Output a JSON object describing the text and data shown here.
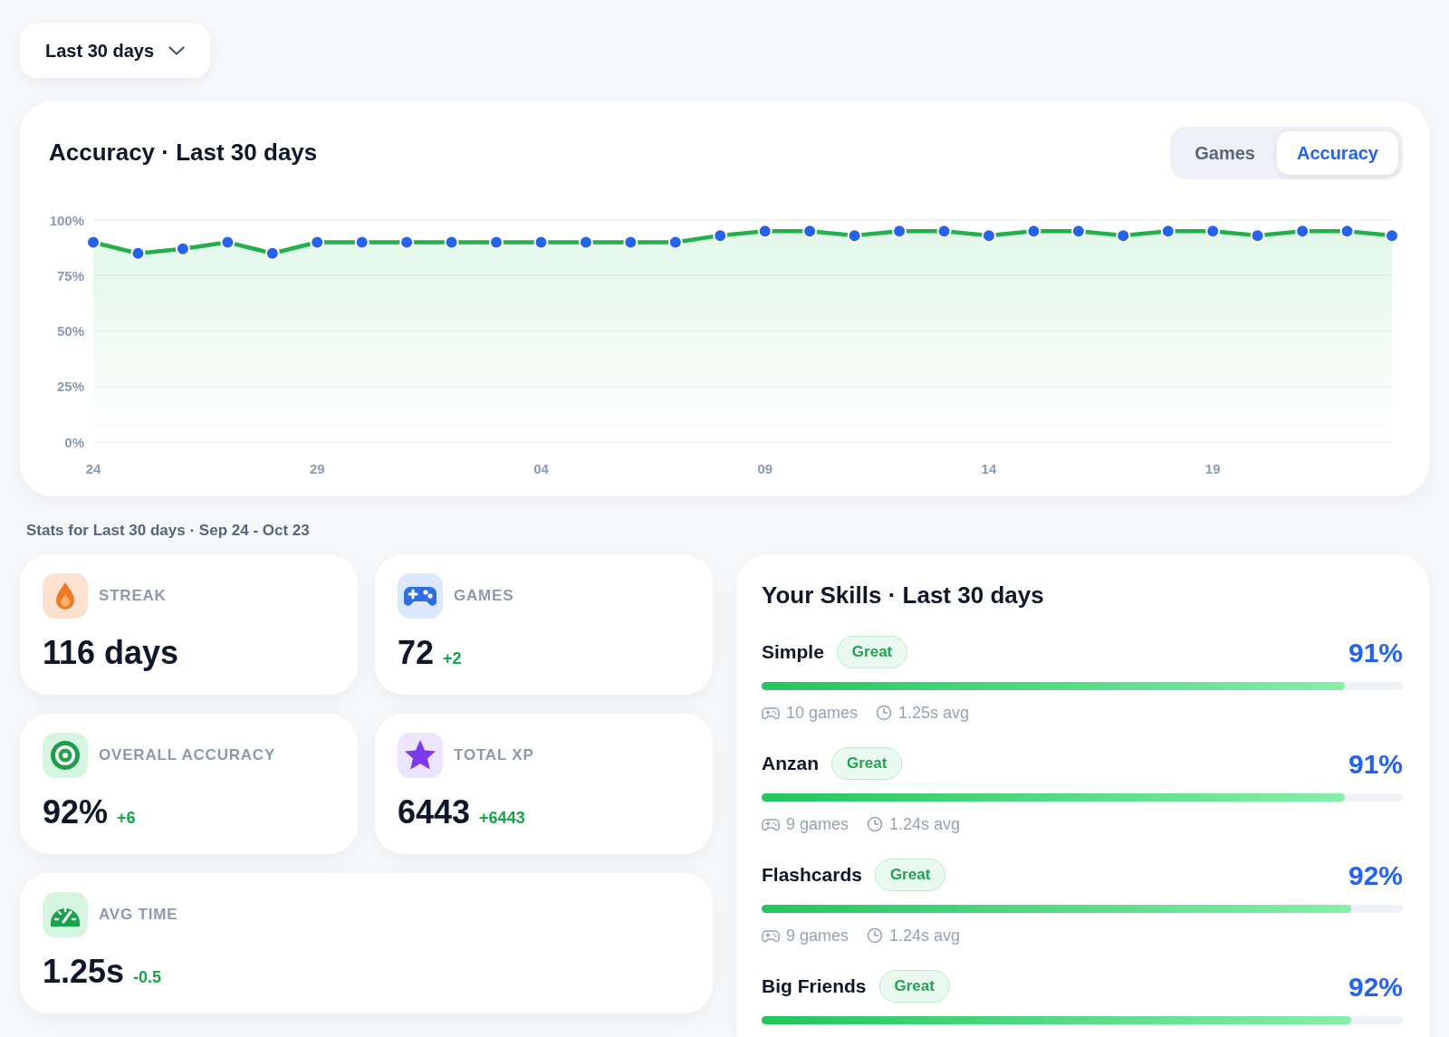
{
  "period_dropdown": {
    "label": "Last 30 days"
  },
  "accuracy_chart": {
    "tabs": [
      {
        "label": "Games",
        "selected": false
      },
      {
        "label": "Accuracy",
        "selected": true
      }
    ],
    "chart_data": {
      "type": "line",
      "title": "Accuracy · Last 30 days",
      "categories": [
        "24",
        null,
        null,
        null,
        null,
        "29",
        null,
        null,
        null,
        null,
        "04",
        null,
        null,
        null,
        null,
        "09",
        null,
        null,
        null,
        null,
        "14",
        null,
        null,
        null,
        null,
        "19",
        null,
        null,
        null,
        null
      ],
      "ylim": [
        0,
        100
      ],
      "yticks": [
        {
          "value": 0,
          "label": "0%"
        },
        {
          "value": 25,
          "label": "25%"
        },
        {
          "value": 50,
          "label": "50%"
        },
        {
          "value": 75,
          "label": "75%"
        },
        {
          "value": 100,
          "label": "100%"
        }
      ],
      "grid": true,
      "series": [
        {
          "color": "#22b04b",
          "marker": "circle",
          "values": [
            90,
            85,
            87,
            90,
            85,
            90,
            90,
            90,
            90,
            90,
            90,
            90,
            90,
            90,
            93,
            95,
            95,
            93,
            95,
            95,
            93,
            95,
            95,
            93,
            95,
            95,
            93,
            95,
            95,
            93
          ]
        }
      ]
    }
  },
  "stats": {
    "heading": "Stats for Last 30 days · Sep 24 - Oct 23",
    "cards": [
      {
        "kind": "streak",
        "label": "STREAK",
        "value": "116 days"
      },
      {
        "kind": "games",
        "label": "GAMES",
        "value": "72",
        "delta": "+2"
      },
      {
        "kind": "accuracy",
        "label": "OVERALL ACCURACY",
        "value": "92%",
        "delta": "+6"
      },
      {
        "kind": "xp",
        "label": "TOTAL XP",
        "value": "6443",
        "delta": "+6443"
      },
      {
        "kind": "time",
        "label": "AVG TIME",
        "value": "1.25s",
        "delta": "-0.5"
      }
    ]
  },
  "skills": {
    "title": "Your Skills · Last 30 days",
    "items": [
      {
        "name": "Simple",
        "rating": "Great",
        "percent": "91%",
        "level": 0.91,
        "games": "10 games",
        "avg_time": "1.25s avg"
      },
      {
        "name": "Anzan",
        "rating": "Great",
        "percent": "91%",
        "level": 0.91,
        "games": "9 games",
        "avg_time": "1.24s avg"
      },
      {
        "name": "Flashcards",
        "rating": "Great",
        "percent": "92%",
        "level": 0.92,
        "games": "9 games",
        "avg_time": "1.24s avg"
      },
      {
        "name": "Big Friends",
        "rating": "Great",
        "percent": "92%",
        "level": 0.92
      }
    ]
  }
}
